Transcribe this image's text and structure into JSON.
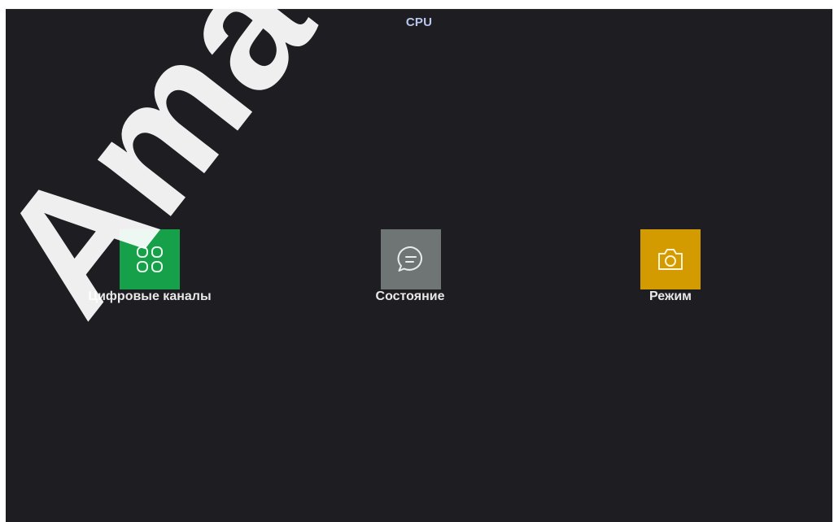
{
  "header": {
    "title": "CPU"
  },
  "menu": {
    "items": [
      {
        "label": "Цифровые каналы",
        "icon": "grid-icon",
        "color": "#17a04a"
      },
      {
        "label": "Состояние",
        "icon": "message-icon",
        "color": "#6f7474"
      },
      {
        "label": "Режим",
        "icon": "camera-icon",
        "color": "#d49b00"
      }
    ]
  },
  "watermark": {
    "text": "Amat"
  }
}
